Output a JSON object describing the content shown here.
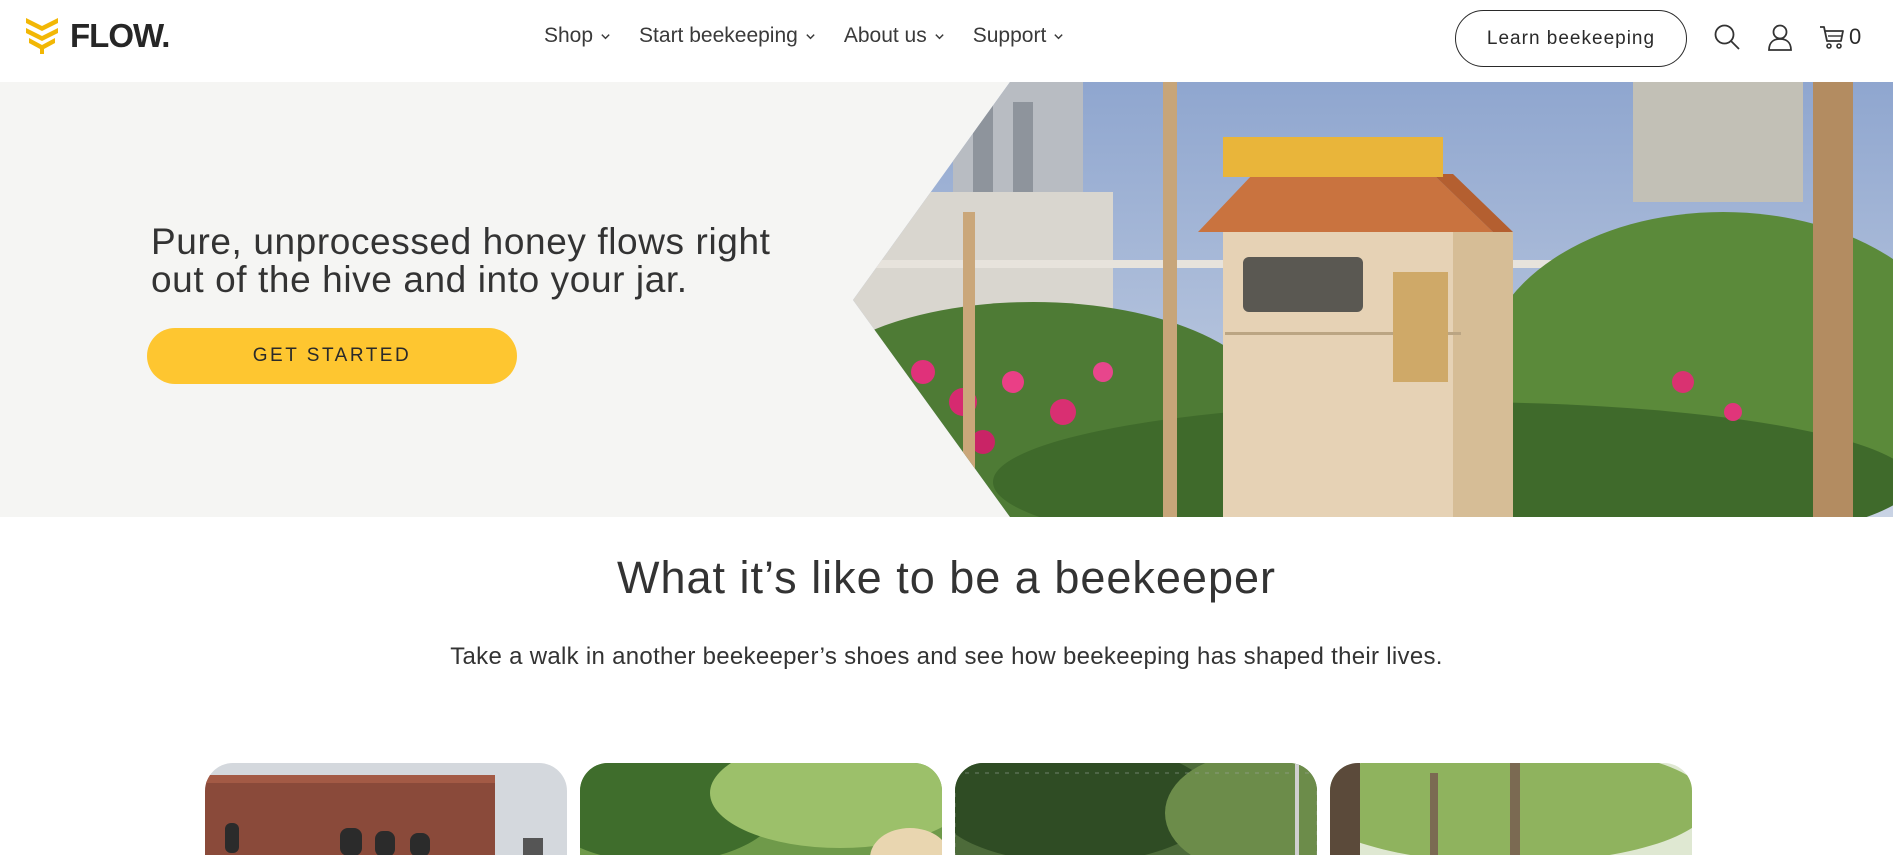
{
  "header": {
    "logo_text": "FLOW.",
    "logo_icon": "flow-logo-icon",
    "nav": [
      {
        "label": "Shop"
      },
      {
        "label": "Start beekeeping"
      },
      {
        "label": "About us"
      },
      {
        "label": "Support"
      }
    ],
    "learn_button": "Learn beekeeping",
    "search_icon": "search-icon",
    "account_icon": "user-icon",
    "cart_icon": "cart-icon",
    "cart_count": "0"
  },
  "hero": {
    "headline": "Pure, unprocessed honey flows right out of the hive and into your jar.",
    "cta": "GET STARTED",
    "accent_color": "#fec630",
    "image": "flow-hive-rooftop-garden-image"
  },
  "stories": {
    "title": "What it’s like to be a beekeeper",
    "subtitle": "Take a walk in another beekeeper’s shoes and see how beekeeping has shaped their lives.",
    "cards": [
      {
        "image": "brick-building-image"
      },
      {
        "image": "garden-beekeeper-image"
      },
      {
        "image": "fenced-garden-image"
      },
      {
        "image": "trees-backyard-image"
      }
    ]
  }
}
